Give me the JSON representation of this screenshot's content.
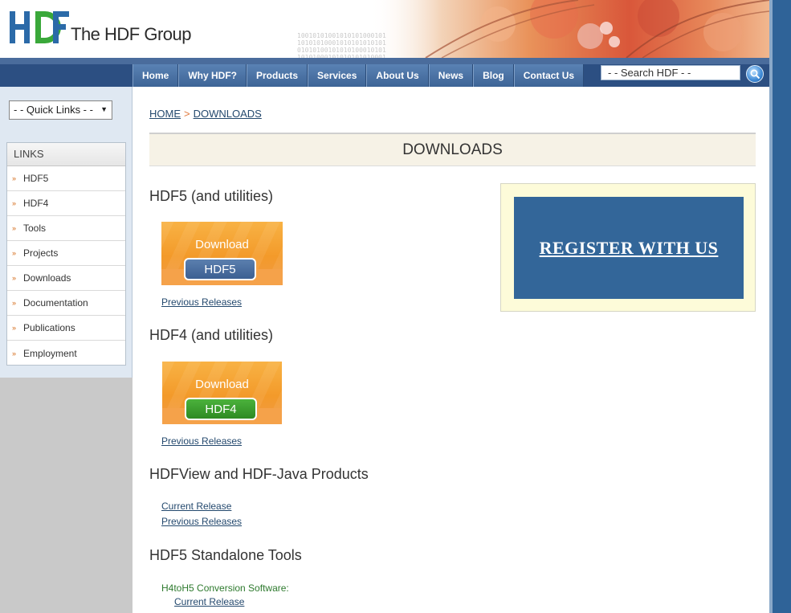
{
  "header": {
    "logo_mark": "HDF",
    "logo_text": "The HDF Group",
    "colors": {
      "logo_blue": "#2b6aa8",
      "logo_green": "#3aa83a",
      "nav_bg": "#2c4f82",
      "accent_orange": "#e07a3e"
    }
  },
  "nav": {
    "items": [
      "Home",
      "Why HDF?",
      "Products",
      "Services",
      "About Us",
      "News",
      "Blog",
      "Contact Us"
    ],
    "search_placeholder": "- - Search HDF - -",
    "search_icon": "magnifier-icon"
  },
  "sidebar": {
    "quick_links": "- - Quick Links - -",
    "quick_links_arrow": "▼",
    "links_title": "LINKS",
    "items": [
      "HDF5",
      "HDF4",
      "Tools",
      "Projects",
      "Downloads",
      "Documentation",
      "Publications",
      "Employment"
    ]
  },
  "breadcrumb": {
    "home": "HOME",
    "sep": ">",
    "current": "DOWNLOADS"
  },
  "main": {
    "title": "DOWNLOADS",
    "sections": [
      {
        "heading": "HDF5 (and utilities)",
        "button_word": "Download",
        "button_pill": "HDF5",
        "link": "Previous Releases"
      },
      {
        "heading": "HDF4 (and utilities)",
        "button_word": "Download",
        "button_pill": "HDF4",
        "link": "Previous Releases"
      },
      {
        "heading": "HDFView and HDF-Java Products",
        "link_current": "Current Release",
        "link_previous": "Previous Releases"
      },
      {
        "heading": "HDF5 Standalone Tools",
        "sub_label": "H4toH5 Conversion Software:",
        "link_current": "Current Release"
      }
    ],
    "register": "REGISTER WITH US"
  }
}
